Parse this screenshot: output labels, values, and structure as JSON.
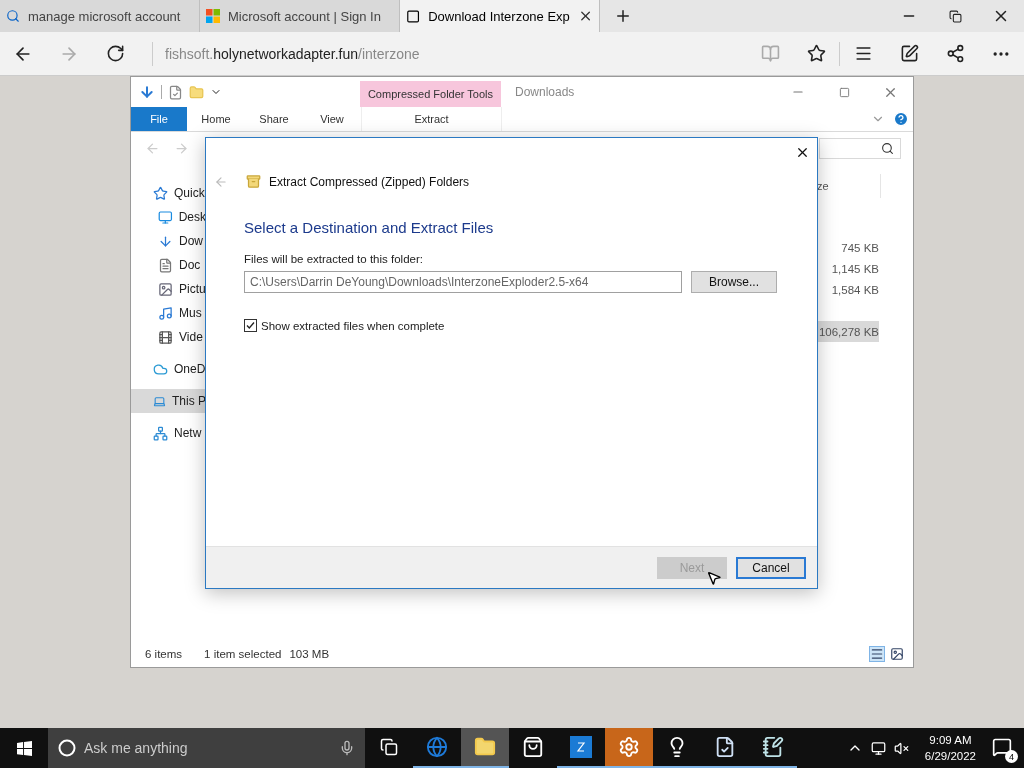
{
  "browser": {
    "tabs": [
      {
        "title": "manage microsoft account",
        "selected": false
      },
      {
        "title": "Microsoft account | Sign In",
        "selected": false
      },
      {
        "title": "Download Interzone Exp",
        "selected": true
      }
    ],
    "address": {
      "subdomain": "fishsoft.",
      "domain": "holynetworkadapter.fun",
      "path": "/interzone"
    },
    "forward_disabled": true,
    "reading_view_disabled": true
  },
  "explorer": {
    "context_tab": "Compressed Folder Tools",
    "title": "Downloads",
    "ribbon_tabs": [
      {
        "label": "File",
        "kind": "file"
      },
      {
        "label": "Home",
        "kind": "tab"
      },
      {
        "label": "Share",
        "kind": "tab"
      },
      {
        "label": "View",
        "kind": "tab"
      },
      {
        "label": "Extract",
        "kind": "context"
      }
    ],
    "nav": [
      {
        "label": "Quick",
        "selected": false,
        "children": [
          {
            "label": "Desk",
            "selected": false
          },
          {
            "label": "Dow",
            "selected": false
          },
          {
            "label": "Doc",
            "selected": false
          },
          {
            "label": "Pictu",
            "selected": false
          },
          {
            "label": "Mus",
            "selected": false
          },
          {
            "label": "Vide",
            "selected": false
          }
        ]
      },
      {
        "label": "OneD",
        "selected": false
      },
      {
        "label": "This P",
        "selected": true
      },
      {
        "label": "Netw",
        "selected": false
      }
    ],
    "column_header": "ze",
    "rows": [
      {
        "kind": "folder",
        "selected": false
      },
      {
        "kind": "file",
        "size": "745 KB",
        "selected": false
      },
      {
        "kind": "file",
        "size": "1,145 KB",
        "selected": false
      },
      {
        "kind": "file",
        "size": "1,584 KB",
        "selected": false
      },
      {
        "kind": "folder",
        "selected": false
      },
      {
        "kind": "file",
        "size": "106,278 KB",
        "selected": true
      }
    ],
    "status": {
      "count": "6 items",
      "selection": "1 item selected",
      "size": "103 MB"
    }
  },
  "dialog": {
    "title": "Extract Compressed (Zipped) Folders",
    "heading": "Select a Destination and Extract Files",
    "label": "Files will be extracted to this folder:",
    "path": "C:\\Users\\Darrin DeYoung\\Downloads\\InterzoneExploder2.5-x64",
    "browse": "Browse...",
    "checkbox": {
      "label": "Show extracted files when complete",
      "checked": true
    },
    "buttons": [
      {
        "label": "Next",
        "disabled": true,
        "default": false
      },
      {
        "label": "Cancel",
        "disabled": false,
        "default": true
      }
    ]
  },
  "taskbar": {
    "search_placeholder": "Ask me anything",
    "apps": [
      {
        "running": true,
        "selected": false
      },
      {
        "running": true,
        "selected": true
      },
      {
        "running": false,
        "selected": false
      },
      {
        "running": true,
        "selected": false
      },
      {
        "running": true,
        "selected": false
      },
      {
        "running": true,
        "selected": false
      },
      {
        "running": true,
        "selected": false
      },
      {
        "running": true,
        "selected": false
      }
    ],
    "time": "9:09 AM",
    "date": "6/29/2022",
    "notifications": "4"
  }
}
